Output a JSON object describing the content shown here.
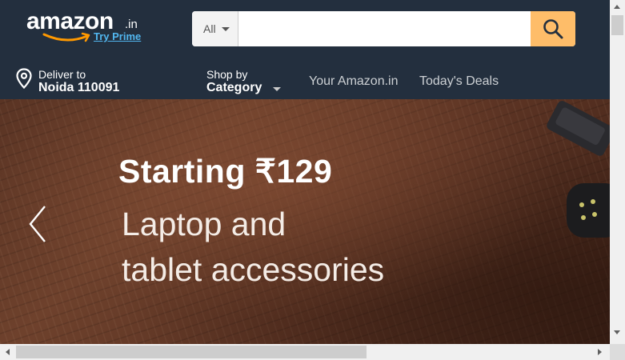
{
  "header": {
    "logo": {
      "wordmark": "amazon",
      "tld": ".in",
      "prime_link": "Try Prime"
    },
    "search": {
      "department": "All",
      "query": "",
      "placeholder": "",
      "button_icon": "search-icon"
    }
  },
  "nav": {
    "deliver": {
      "line1": "Deliver to",
      "line2": "Noida 110091",
      "icon": "location-pin-icon"
    },
    "shop_by": {
      "line1": "Shop by",
      "line2": "Category"
    },
    "links": [
      "Your Amazon.in",
      "Today's Deals"
    ]
  },
  "hero": {
    "title": "Starting ₹129",
    "line1": "Laptop and",
    "line2": "tablet accessories",
    "prev_icon": "chevron-left-icon"
  },
  "colors": {
    "nav_bg": "#232f3e",
    "search_button": "#febd69",
    "prime_link": "#52b7f0",
    "smile": "#ff9900"
  }
}
